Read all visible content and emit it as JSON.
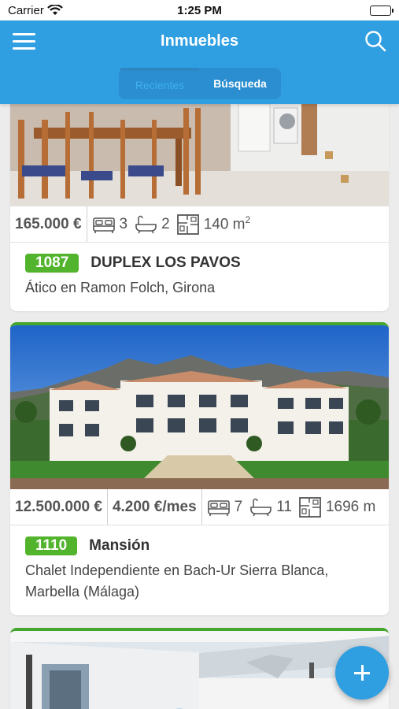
{
  "status_bar": {
    "carrier": "Carrier",
    "time": "1:25 PM"
  },
  "header": {
    "title": "Inmuebles",
    "segments": [
      "Recientes",
      "Búsqueda"
    ]
  },
  "colors": {
    "brand": "#2f9fe2",
    "badge": "#52b32c"
  },
  "listings": [
    {
      "price": "165.000 €",
      "bedrooms": "3",
      "bathrooms": "2",
      "area": "140 m",
      "area_unit_exp": "2",
      "ref": "1087",
      "name": "DUPLEX LOS PAVOS",
      "location": "Ático en Ramon Folch, Girona"
    },
    {
      "price": "12.500.000 €",
      "rent": "4.200 €/mes",
      "bedrooms": "7",
      "bathrooms": "11",
      "area": "1696 m",
      "ref": "1110",
      "name": "Mansión",
      "location": "Chalet Independiente en Bach-Ur Sierra Blanca, Marbella (Málaga)"
    }
  ],
  "icons": [
    "menu-icon",
    "search-icon",
    "bed-icon",
    "bathtub-icon",
    "floorplan-icon",
    "plus-icon"
  ]
}
